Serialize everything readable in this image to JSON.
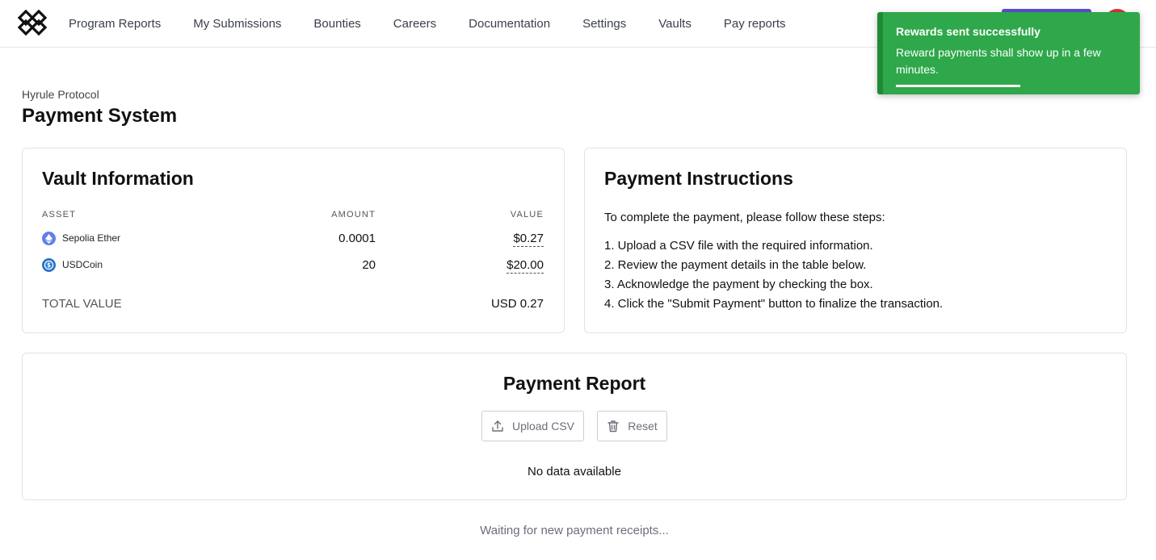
{
  "nav": {
    "logo_icon": "diamond-lattice-logo-icon",
    "items": [
      "Program Reports",
      "My Submissions",
      "Bounties",
      "Careers",
      "Documentation",
      "Settings",
      "Vaults",
      "Pay reports"
    ]
  },
  "toast": {
    "title": "Rewards sent successfully",
    "message": "Reward payments shall show up in a few minutes.",
    "color": "#2ea84a"
  },
  "page": {
    "breadcrumb": "Hyrule Protocol",
    "title": "Payment System"
  },
  "vault": {
    "title": "Vault Information",
    "columns": {
      "asset": "ASSET",
      "amount": "AMOUNT",
      "value": "VALUE"
    },
    "rows": [
      {
        "icon": "ethereum-icon",
        "asset": "Sepolia Ether",
        "amount": "0.0001",
        "value": "$0.27"
      },
      {
        "icon": "usdc-icon",
        "asset": "USDCoin",
        "amount": "20",
        "value": "$20.00"
      }
    ],
    "total_label": "TOTAL VALUE",
    "total_value": "USD 0.27"
  },
  "instructions": {
    "title": "Payment Instructions",
    "intro": "To complete the payment, please follow these steps:",
    "steps": [
      "1. Upload a CSV file with the required information.",
      "2. Review the payment details in the table below.",
      "3. Acknowledge the payment by checking the box.",
      "4. Click the \"Submit Payment\" button to finalize the transaction."
    ]
  },
  "report": {
    "title": "Payment Report",
    "upload_label": "Upload CSV",
    "reset_label": "Reset",
    "empty_text": "No data available"
  },
  "footer": {
    "waiting_text": "Waiting for new payment receipts..."
  }
}
